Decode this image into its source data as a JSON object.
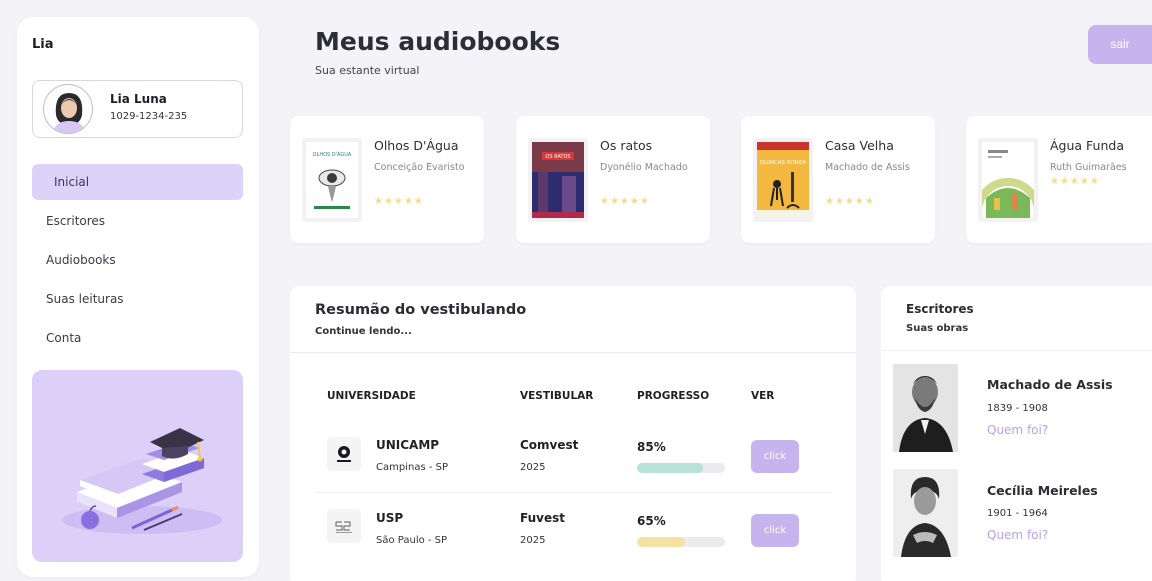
{
  "sidebar": {
    "app_name": "Lia",
    "profile": {
      "name": "Lia Luna",
      "id": "1029-1234-235"
    },
    "nav": [
      {
        "label": "Inicial",
        "active": true
      },
      {
        "label": "Escritores",
        "active": false
      },
      {
        "label": "Audiobooks",
        "active": false
      },
      {
        "label": "Suas leituras",
        "active": false
      },
      {
        "label": "Conta",
        "active": false
      }
    ]
  },
  "header": {
    "title": "Meus audiobooks",
    "subtitle": "Sua estante virtual",
    "logout_label": "sair"
  },
  "books": [
    {
      "title": "Olhos D'Água",
      "author": "Conceição Evaristo",
      "rating": 5,
      "cover_text": "OLHOS D'ÁGUA"
    },
    {
      "title": "Os ratos",
      "author": "Dyonélio Machado",
      "rating": 5,
      "cover_text": "OS RATOS"
    },
    {
      "title": "Casa Velha",
      "author": "Machado de Assis",
      "rating": 5,
      "cover_text": "QUINCAS BORBA"
    },
    {
      "title": "Água Funda",
      "author": "Ruth Guimarães",
      "rating": 5,
      "cover_text": ""
    }
  ],
  "stars": "★★★★★",
  "summary": {
    "title": "Resumão do vestibulando",
    "subtitle": "Continue lendo...",
    "headers": {
      "university": "UNIVERSIDADE",
      "exam": "VESTIBULAR",
      "progress": "PROGRESSO",
      "view": "VER"
    },
    "rows": [
      {
        "university": "UNICAMP",
        "location": "Campinas - SP",
        "exam": "Comvest",
        "year": "2025",
        "progress_label": "85%",
        "progress": 0.75,
        "button_label": "click",
        "color": "#b6e3d6"
      },
      {
        "university": "USP",
        "location": "São Paulo - SP",
        "exam": "Fuvest",
        "year": "2025",
        "progress_label": "65%",
        "progress": 0.55,
        "button_label": "click",
        "color": "#f6e1a4"
      }
    ]
  },
  "writers": {
    "title": "Escritores",
    "subtitle": "Suas obras",
    "items": [
      {
        "name": "Machado de Assis",
        "years": "1839 - 1908",
        "link": "Quem foi?"
      },
      {
        "name": "Cecília Meireles",
        "years": "1901 - 1964",
        "link": "Quem foi?"
      }
    ]
  },
  "colors": {
    "accent": "#c7b4ee",
    "accent_light": "#ddd2f7",
    "link": "#b7a1ea",
    "star": "#f5dc8d"
  }
}
